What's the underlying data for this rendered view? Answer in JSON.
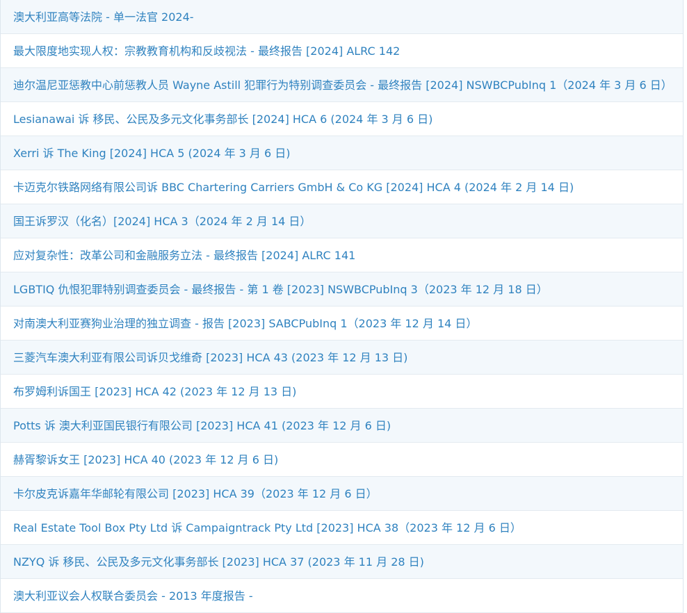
{
  "results": [
    {
      "title": "澳大利亚高等法院 - 单一法官 2024-"
    },
    {
      "title": "最大限度地实现人权：宗教教育机构和反歧视法 - 最终报告 [2024] ALRC 142"
    },
    {
      "title": "迪尔温尼亚惩教中心前惩教人员 Wayne Astill 犯罪行为特别调查委员会 - 最终报告 [2024] NSWBCPubInq 1（2024 年 3 月 6 日）"
    },
    {
      "title": "Lesianawai 诉 移民、公民及多元文化事务部长 [2024] HCA 6 (2024 年 3 月 6 日)"
    },
    {
      "title": "Xerri 诉 The King [2024] HCA 5 (2024 年 3 月 6 日)"
    },
    {
      "title": "卡迈克尔铁路网络有限公司诉 BBC Chartering Carriers GmbH & Co KG [2024] HCA 4 (2024 年 2 月 14 日)"
    },
    {
      "title": "国王诉罗汉（化名）[2024] HCA 3（2024 年 2 月 14 日）"
    },
    {
      "title": "应对复杂性：改革公司和金融服务立法 - 最终报告 [2024] ALRC 141"
    },
    {
      "title": "LGBTIQ 仇恨犯罪特别调查委员会 - 最终报告 - 第 1 卷 [2023] NSWBCPubInq 3（2023 年 12 月 18 日）"
    },
    {
      "title": "对南澳大利亚赛狗业治理的独立调查 - 报告 [2023] SABCPubInq 1（2023 年 12 月 14 日）"
    },
    {
      "title": "三菱汽车澳大利亚有限公司诉贝戈维奇 [2023] HCA 43 (2023 年 12 月 13 日)"
    },
    {
      "title": "布罗姆利诉国王 [2023] HCA 42 (2023 年 12 月 13 日)"
    },
    {
      "title": "Potts 诉 澳大利亚国民银行有限公司 [2023] HCA 41 (2023 年 12 月 6 日)"
    },
    {
      "title": "赫胥黎诉女王 [2023] HCA 40 (2023 年 12 月 6 日)"
    },
    {
      "title": "卡尔皮克诉嘉年华邮轮有限公司 [2023] HCA 39（2023 年 12 月 6 日）"
    },
    {
      "title": "Real Estate Tool Box Pty Ltd 诉 Campaigntrack Pty Ltd [2023] HCA 38（2023 年 12 月 6 日）"
    },
    {
      "title": "NZYQ 诉 移民、公民及多元文化事务部长 [2023] HCA 37 (2023 年 11 月 28 日)"
    },
    {
      "title": "澳大利亚议会人权联合委员会 - 2013 年度报告 -"
    }
  ],
  "colors": {
    "link": "#2f82bf",
    "row_alt": "#f3f8fc",
    "border": "#e3eaf0"
  }
}
